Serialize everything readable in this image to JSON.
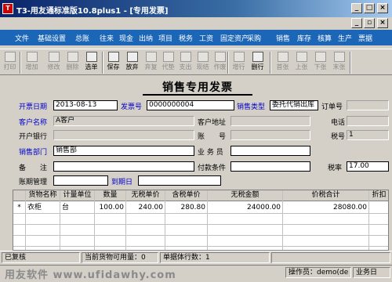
{
  "window": {
    "title": "T3-用友通标准版10.8plus1 - [专用发票]",
    "icon": "yonyou-app-icon"
  },
  "menu": [
    "文件",
    "基础设置",
    "总账",
    "往来",
    "现金",
    "出纳",
    "项目",
    "税务",
    "工资",
    "固定资产",
    "采购",
    "销售",
    "库存",
    "核算",
    "生产",
    "票据"
  ],
  "toolbar": [
    {
      "label": "打印",
      "icon": "printer-icon",
      "enabled": false
    },
    {
      "label": "增加",
      "icon": "add-icon",
      "enabled": false
    },
    {
      "label": "修改",
      "icon": "edit-icon",
      "enabled": false
    },
    {
      "label": "删除",
      "icon": "delete-icon",
      "enabled": false
    },
    {
      "label": "选单",
      "icon": "select-doc-icon",
      "enabled": true
    },
    {
      "label": "保存",
      "icon": "save-icon",
      "enabled": true
    },
    {
      "label": "放弃",
      "icon": "discard-icon",
      "enabled": true
    },
    {
      "label": "弃复",
      "icon": "undo-icon",
      "enabled": false
    },
    {
      "label": "代垫",
      "icon": "advance-icon",
      "enabled": false
    },
    {
      "label": "支出",
      "icon": "expense-icon",
      "enabled": false
    },
    {
      "label": "现结",
      "icon": "cash-settle-icon",
      "enabled": false
    },
    {
      "label": "作废",
      "icon": "void-icon",
      "enabled": false
    },
    {
      "label": "增行",
      "icon": "add-row-icon",
      "enabled": false
    },
    {
      "label": "删行",
      "icon": "delete-row-icon",
      "enabled": true
    },
    {
      "label": "首张",
      "icon": "first-icon",
      "enabled": false
    },
    {
      "label": "上张",
      "icon": "prev-icon",
      "enabled": false
    },
    {
      "label": "下张",
      "icon": "next-icon",
      "enabled": false
    },
    {
      "label": "末张",
      "icon": "last-icon",
      "enabled": false
    }
  ],
  "form": {
    "title": "销售专用发票",
    "invoice_date_label": "开票日期",
    "invoice_date": "2013-08-13",
    "invoice_no_label": "发票号",
    "invoice_no": "0000000004",
    "sales_type_label": "销售类型",
    "sales_type": "委托代销出库",
    "order_no_label": "订单号",
    "order_no": "",
    "customer_label": "客户名称",
    "customer": "A客户",
    "customer_addr_label": "客户地址",
    "customer_addr": "",
    "phone_label": "电话",
    "phone": "",
    "bank_label": "开户银行",
    "bank": "",
    "account_label": "账　　号",
    "account": "",
    "tax_no_label": "税号",
    "tax_no": "1",
    "dept_label": "销售部门",
    "dept": "销售部",
    "salesman_label": "业 务 员",
    "salesman": "",
    "remark_label": "备　　注",
    "remark": "",
    "pay_terms_label": "付款条件",
    "pay_terms": "",
    "tax_rate_label": "税率",
    "tax_rate": "17.00",
    "period_label": "账期管理",
    "period": "",
    "due_date_label": "到期日",
    "due_date": ""
  },
  "grid": {
    "columns": [
      "货物名称",
      "计量单位",
      "数量",
      "无税单价",
      "含税单价",
      "无税金额",
      "价税合计",
      "折扣"
    ],
    "rows": [
      {
        "marker": "*",
        "name": "衣柜",
        "unit": "台",
        "qty": "100.00",
        "price": "240.00",
        "tax_price": "280.80",
        "amount": "24000.00",
        "total": "28080.00",
        "disc": ""
      }
    ]
  },
  "status": {
    "audit": "已复核",
    "stock": "当前货物可用量：0",
    "rows": "单据体行数：1",
    "operator": "操作员：demo(de",
    "module": "业务日"
  },
  "watermark": "用友软件 www.ufidawhy.com"
}
